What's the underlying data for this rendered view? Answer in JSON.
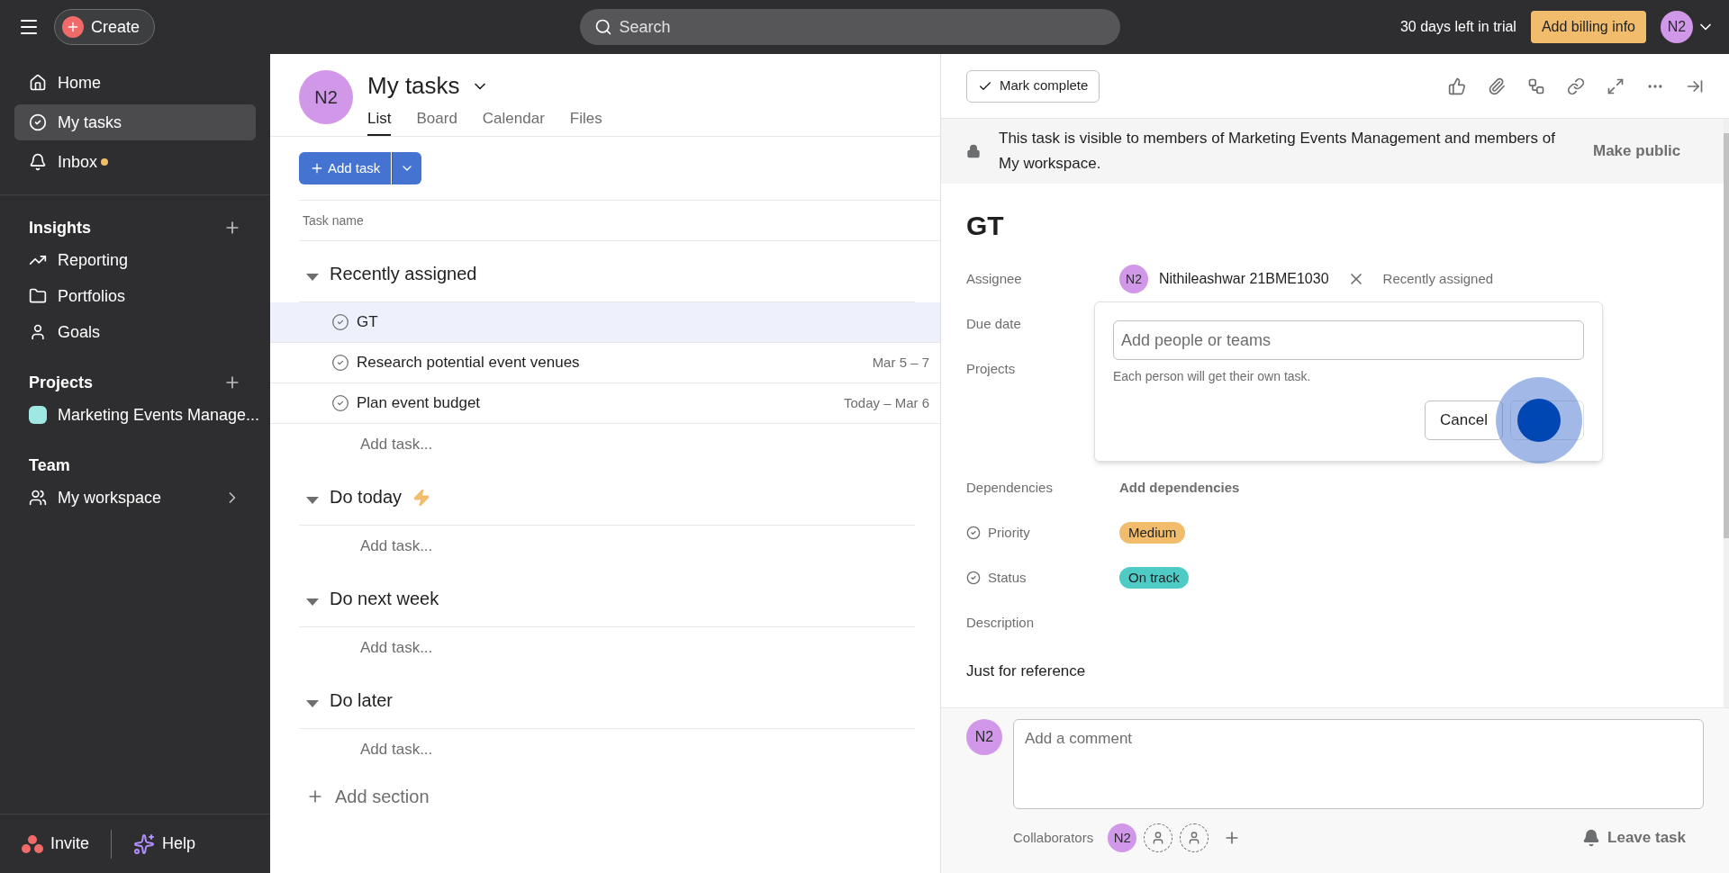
{
  "topbar": {
    "create": "Create",
    "search": {
      "placeholder": "Search"
    },
    "trial": "30 days left in trial",
    "billing": "Add billing info",
    "avatar": "N2"
  },
  "sidebar": {
    "items": [
      {
        "label": "Home",
        "selected": false,
        "dot": false
      },
      {
        "label": "My tasks",
        "selected": true,
        "dot": false
      },
      {
        "label": "Inbox",
        "selected": false,
        "dot": true
      }
    ],
    "groups": [
      {
        "title": "Insights",
        "add": true,
        "items": [
          {
            "label": "Reporting"
          },
          {
            "label": "Portfolios"
          },
          {
            "label": "Goals"
          }
        ]
      },
      {
        "title": "Projects",
        "add": true,
        "items": [
          {
            "label": "Marketing Events Manage...",
            "color": "#9ee7e3"
          }
        ]
      },
      {
        "title": "Team",
        "add": false,
        "items": [
          {
            "label": "My workspace",
            "expandable": true
          }
        ]
      }
    ],
    "invite": "Invite",
    "help": "Help"
  },
  "list": {
    "avatar": "N2",
    "title": "My tasks",
    "tabs": [
      {
        "label": "List",
        "selected": true
      },
      {
        "label": "Board",
        "selected": false
      },
      {
        "label": "Calendar",
        "selected": false
      },
      {
        "label": "Files",
        "selected": false
      }
    ],
    "add_task": "Add task",
    "column": "Task name",
    "sections": [
      {
        "title": "Recently assigned",
        "bolt": false,
        "tasks": [
          {
            "name": "GT",
            "selected": true
          },
          {
            "name": "Research potential event venues",
            "date": "Mar 5 – 7",
            "selected": false
          },
          {
            "name": "Plan event budget",
            "date": "Today – Mar 6",
            "selected": false
          }
        ],
        "add": "Add task..."
      },
      {
        "title": "Do today",
        "bolt": true,
        "add": "Add task..."
      },
      {
        "title": "Do next week",
        "bolt": false,
        "add": "Add task..."
      },
      {
        "title": "Do later",
        "bolt": false,
        "add": "Add task..."
      }
    ],
    "add_section": "Add section"
  },
  "detail": {
    "mark_complete": "Mark complete",
    "notice": "This task is visible to members of Marketing Events Management and members of My workspace.",
    "make_public": "Make public",
    "title": "GT",
    "fields": [
      {
        "label": "Assignee",
        "kind": "assignee",
        "avatar": "N2",
        "value": "Nithileashwar 21BME1030",
        "extra": "Recently assigned"
      },
      {
        "label": "Due date",
        "kind": "hidden"
      },
      {
        "label": "Projects",
        "kind": "projects"
      },
      {
        "label": "Dependencies",
        "kind": "link",
        "value": "Add dependencies"
      },
      {
        "label": "Priority",
        "kind": "tag",
        "value": "Medium",
        "color": "#f1bd6c"
      },
      {
        "label": "Status",
        "kind": "tag",
        "value": "On track",
        "color": "#4ecbc4"
      },
      {
        "label": "Description",
        "kind": "hidden"
      }
    ],
    "description": "Just for reference",
    "popup": {
      "placeholder": "Add people or teams",
      "hint": "Each person will get their own task.",
      "cancel": "Cancel"
    },
    "comment": {
      "avatar": "N2",
      "placeholder": "Add a comment"
    },
    "collaborators": {
      "label": "Collaborators",
      "avatar": "N2"
    },
    "leave": "Leave task"
  }
}
